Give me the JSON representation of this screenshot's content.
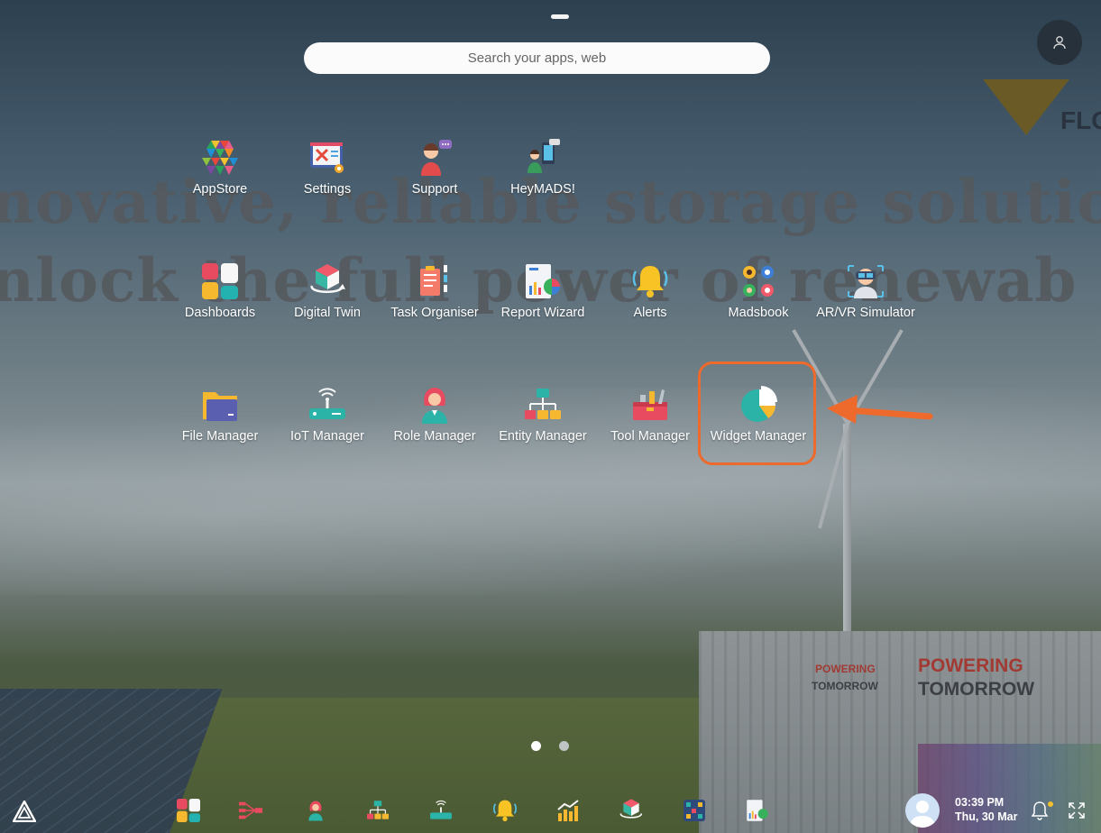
{
  "search": {
    "placeholder": "Search your apps, web"
  },
  "background": {
    "headline_line1": "novative, reliable storage solutio",
    "headline_line2": "nlock the full power of renewab",
    "logo_text": "FLO",
    "container_text_1": "POWERING",
    "container_text_2": "TOMORROW"
  },
  "apps": [
    {
      "label": "AppStore",
      "icon": "appstore-icon"
    },
    {
      "label": "Settings",
      "icon": "settings-icon"
    },
    {
      "label": "Support",
      "icon": "support-icon"
    },
    {
      "label": "HeyMADS!",
      "icon": "heymads-icon"
    },
    {
      "label": "Dashboards",
      "icon": "dashboards-icon"
    },
    {
      "label": "Digital Twin",
      "icon": "digital-twin-icon"
    },
    {
      "label": "Task Organiser",
      "icon": "task-organiser-icon"
    },
    {
      "label": "Report Wizard",
      "icon": "report-wizard-icon"
    },
    {
      "label": "Alerts",
      "icon": "alerts-bell-icon"
    },
    {
      "label": "Madsbook",
      "icon": "madsbook-icon"
    },
    {
      "label": "AR/VR Simulator",
      "icon": "arvr-simulator-icon"
    },
    {
      "label": "File Manager",
      "icon": "file-manager-icon"
    },
    {
      "label": "IoT Manager",
      "icon": "iot-manager-icon"
    },
    {
      "label": "Role Manager",
      "icon": "role-manager-icon"
    },
    {
      "label": "Entity Manager",
      "icon": "entity-manager-icon"
    },
    {
      "label": "Tool Manager",
      "icon": "tool-manager-icon"
    },
    {
      "label": "Widget Manager",
      "icon": "widget-manager-icon"
    }
  ],
  "pagination": {
    "pages": 2,
    "current": 1
  },
  "taskbar": {
    "time": "03:39 PM",
    "date": "Thu, 30 Mar",
    "dock": [
      "dashboards-icon",
      "flow-icon",
      "role-manager-icon",
      "entity-manager-icon",
      "iot-manager-icon",
      "alerts-bell-icon",
      "analytics-icon",
      "digital-twin-icon",
      "network-icon",
      "report-wizard-icon"
    ]
  },
  "colors": {
    "highlight": "#ee6a2c",
    "notification_dot": "#f2c230"
  }
}
